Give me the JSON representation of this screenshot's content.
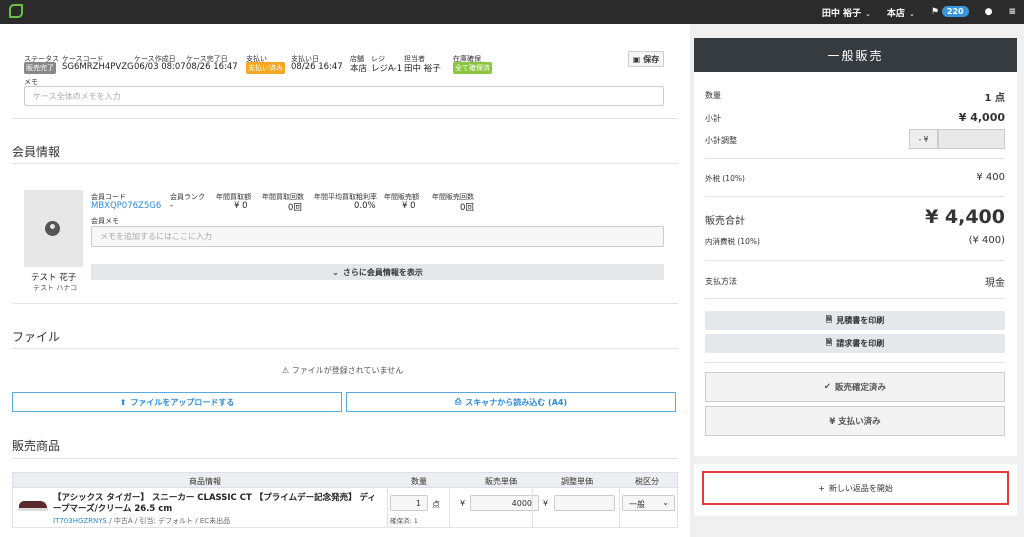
{
  "topbar": {
    "user": "田中 裕子",
    "store": "本店",
    "badge_count": "220"
  },
  "case": {
    "labels": {
      "status": "ステータス",
      "code": "ケースコード",
      "created": "ケース作成日",
      "completed": "ケース完了日",
      "payment": "支払い",
      "paid_date": "支払い日",
      "store": "店舗",
      "register": "レジ",
      "staff": "担当者",
      "stock": "在庫確保"
    },
    "status_tag": "販売完了",
    "code": "SG6MRZH4PVZG",
    "created": "06/03 08:07",
    "completed": "08/26 16:47",
    "payment_tag": "支払い済み",
    "paid_date": "08/26 16:47",
    "store": "本店",
    "register": "レジA-1",
    "staff": "田中 裕子",
    "stock_tag": "全て確保済",
    "save": "保存",
    "memo_label": "メモ",
    "memo_placeholder": "ケース全体のメモを入力"
  },
  "member": {
    "heading": "会員情報",
    "name": "テスト 花子",
    "kana": "テスト ハナコ",
    "labels": {
      "code": "会員コード",
      "rank": "会員ランク",
      "buy_amount": "年間買取額",
      "buy_count": "年間買取回数",
      "avg_rate": "年間平均買取粗利率",
      "sale_amount": "年間販売額",
      "sale_count": "年間販売回数"
    },
    "code": "MBXQP076Z5G6",
    "rank": "-",
    "buy_amount": "¥ 0",
    "buy_count": "0回",
    "avg_rate": "0.0%",
    "sale_amount": "¥ 0",
    "sale_count": "0回",
    "memo_label": "会員メモ",
    "memo_placeholder": "メモを追加するにはここに入力",
    "more": "さらに会員情報を表示"
  },
  "files": {
    "heading": "ファイル",
    "empty": "ファイルが登録されていません",
    "upload": "ファイルをアップロードする",
    "scan": "スキャナから読み込む (A4)"
  },
  "products": {
    "heading": "販売商品",
    "columns": [
      "商品情報",
      "数量",
      "販売単価",
      "調整単価",
      "税区分"
    ],
    "item": {
      "name": "【アシックス タイガー】 スニーカー CLASSIC CT 【プライムデー記念発売】 ディープマーズ/クリーム 26.5 cm",
      "code": "IT703HGZRNYS",
      "meta": " / 中古A / 引当: デフォルト / EC未出品",
      "qty": "1",
      "qty_unit": "点",
      "reserved": "確保済: 1",
      "yen": "¥",
      "price": "4000",
      "tax": "一般"
    }
  },
  "summary": {
    "title": "一般販売",
    "qty_label": "数量",
    "qty": "1 点",
    "subtotal_label": "小計",
    "subtotal": "¥ 4,000",
    "adjust_label": "小計調整",
    "adjust_prefix": "- ¥",
    "tax_ext_label": "外税 (10%)",
    "tax_ext": "¥ 400",
    "total_label": "販売合計",
    "total": "¥ 4,400",
    "tax_int_label": "内消費税 (10%)",
    "tax_int": "(¥ 400)",
    "pay_label": "支払方法",
    "pay": "現金",
    "estimate": "見積書を印刷",
    "invoice": "請求書を印刷",
    "confirmed": "販売確定済み",
    "paid": "¥ 支払い済み",
    "new_return": "新しい返品を開始"
  },
  "colors": {
    "green_tag": "#8cc63f",
    "orange_tag": "#f5a623",
    "gray_tag": "#888888",
    "accent": "#2a8ad6",
    "highlight": "#e53935"
  }
}
